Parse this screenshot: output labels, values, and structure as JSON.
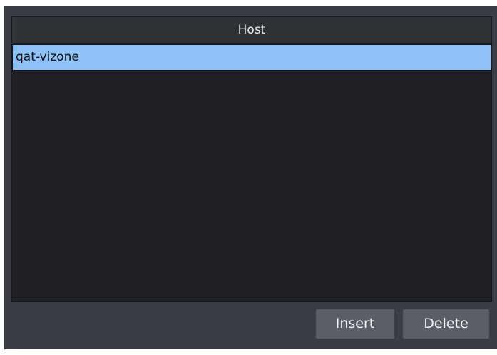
{
  "table": {
    "column_header": "Host",
    "rows": [
      {
        "host": "qat-vizone",
        "selected": true
      }
    ]
  },
  "buttons": {
    "insert_label": "Insert",
    "delete_label": "Delete"
  },
  "colors": {
    "selection": "#8fc2f7",
    "panel_bg": "#3a3d43",
    "table_bg": "#1f2126",
    "button_bg": "#5a5e65"
  }
}
